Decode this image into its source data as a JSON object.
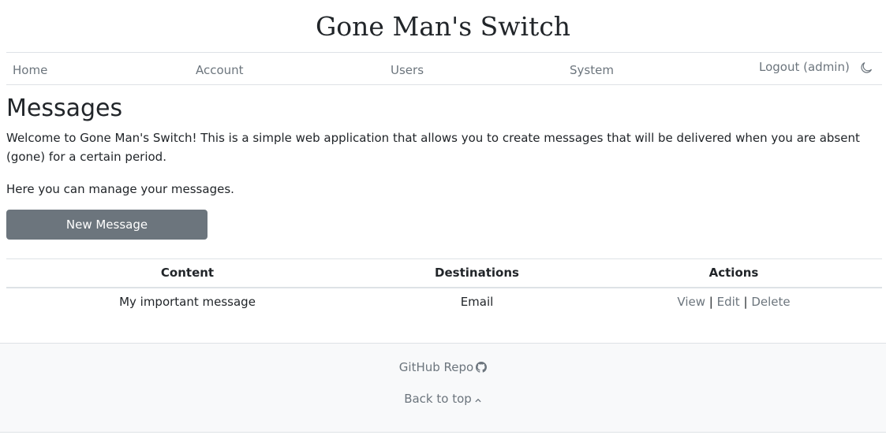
{
  "site": {
    "title": "Gone Man's Switch"
  },
  "nav": {
    "home": "Home",
    "account": "Account",
    "users": "Users",
    "system": "System",
    "logout": "Logout (admin)",
    "theme_icon": "moon-icon"
  },
  "main": {
    "heading": "Messages",
    "intro": "Welcome to Gone Man's Switch! This is a simple web application that allows you to create messages that will be delivered when you are absent (gone) for a certain period.",
    "manage_text": "Here you can manage your messages.",
    "new_button": "New Message"
  },
  "table": {
    "headers": {
      "content": "Content",
      "destinations": "Destinations",
      "actions": "Actions"
    },
    "rows": [
      {
        "content": "My important message",
        "destinations": "Email",
        "actions": {
          "view": "View",
          "edit": "Edit",
          "delete": "Delete"
        }
      }
    ],
    "separator": "|"
  },
  "footer": {
    "github": "GitHub Repo",
    "github_icon": "github-icon",
    "back_to_top": "Back to top",
    "back_icon": "chevron-up-icon"
  },
  "colors": {
    "muted": "#6c757d",
    "text": "#212529",
    "border": "#dee2e6",
    "footer_bg": "#f8f9fa",
    "button_bg": "#6c757d"
  }
}
